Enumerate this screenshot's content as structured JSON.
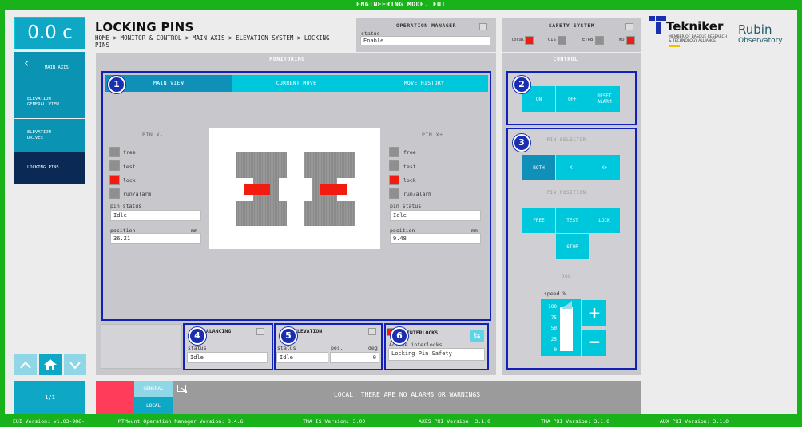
{
  "top_banner": "ENGINEERING MODE. EUI",
  "speed_display": "0.0 c",
  "nav": {
    "items": [
      {
        "label": "MAIN AXIS"
      },
      {
        "label": "ELEVATION GENERAL VIEW"
      },
      {
        "label": "ELEVATION DRIVES"
      },
      {
        "label": "LOCKING PINS"
      }
    ],
    "page_indicator": "1/1"
  },
  "header": {
    "title": "LOCKING PINS",
    "breadcrumb": "HOME > MONITOR & CONTROL > MAIN AXIS > ELEVATION SYSTEM > LOCKING PINS"
  },
  "operation_manager": {
    "title": "OPERATION MANAGER",
    "status_label": "status",
    "status_value": "Enable"
  },
  "safety_system": {
    "title": "SAFETY SYSTEM",
    "items": [
      "local",
      "GIS",
      "ETPB",
      "WD"
    ]
  },
  "logos": {
    "tekniker": "Tekniker",
    "tekniker_sub": "MEMBER OF BASQUE RESEARCH & TECHNOLOGY ALLIANCE",
    "rubin": "Rubin",
    "rubin_sub": "Observatory"
  },
  "monitoring": {
    "title": "MONITORING",
    "tabs": [
      "MAIN VIEW",
      "CURRENT MOVE",
      "MOVE HISTORY"
    ],
    "pin_minus": {
      "title": "PIN X-",
      "states": [
        "free",
        "test",
        "lock",
        "run/alarm"
      ],
      "pin_status_label": "pin status",
      "pin_status": "Idle",
      "position_label": "position",
      "position_unit": "mm",
      "position": "36.21"
    },
    "pin_plus": {
      "title": "PIN X+",
      "states": [
        "free",
        "test",
        "lock",
        "run/alarm"
      ],
      "pin_status_label": "pin status",
      "pin_status": "Idle",
      "position_label": "position",
      "position_unit": "mm",
      "position": "9.48"
    }
  },
  "balancing": {
    "title": "BALANCING",
    "status_label": "status",
    "status": "Idle"
  },
  "elevation": {
    "title": "ELEVATION",
    "status_label": "status",
    "status": "Idle",
    "pos_label": "pos.",
    "pos_unit": "deg",
    "pos": "0"
  },
  "interlocks": {
    "title": "INTERLOCKS",
    "label": "Active interlocks",
    "value": "Locking Pin Safety"
  },
  "control": {
    "title": "CONTROL",
    "buttons": [
      "ON",
      "OFF",
      "RESET ALARM"
    ],
    "pin_selector_title": "PIN SELECTOR",
    "pin_selector": [
      "BOTH",
      "X-",
      "X+"
    ],
    "pin_position_title": "PIN POSITION",
    "pin_position": [
      "FREE",
      "TEST",
      "LOCK",
      "STOP"
    ],
    "jog_title": "JOG",
    "speed_label": "speed %",
    "speed_ticks": [
      "100",
      "75",
      "50",
      "25",
      "0"
    ],
    "speed_level": 1.0,
    "plus": "+",
    "minus": "−"
  },
  "badges": [
    "1",
    "2",
    "3",
    "4",
    "5",
    "6"
  ],
  "alarm_bar": {
    "general": "GENERAL",
    "local": "LOCAL",
    "message": "LOCAL: THERE ARE NO ALARMS OR WARNINGS"
  },
  "versions": [
    "EUI Version: v1.03-986-",
    "MTMount Operation Manager Version: 3.4.6",
    "TMA IS Version: 3.00",
    "AXES PXI Version: 3.1.0",
    "TMA PXI Version: 3.1.0",
    "AUX PXI Version: 3.1.0"
  ],
  "colors": {
    "banner_green": "#1ab21a",
    "teal": "#0ea7c6",
    "cyan": "#00c8dc",
    "navy": "#0a2a55",
    "alarm_red": "#f21b10",
    "highlight_blue": "#1020b8"
  }
}
